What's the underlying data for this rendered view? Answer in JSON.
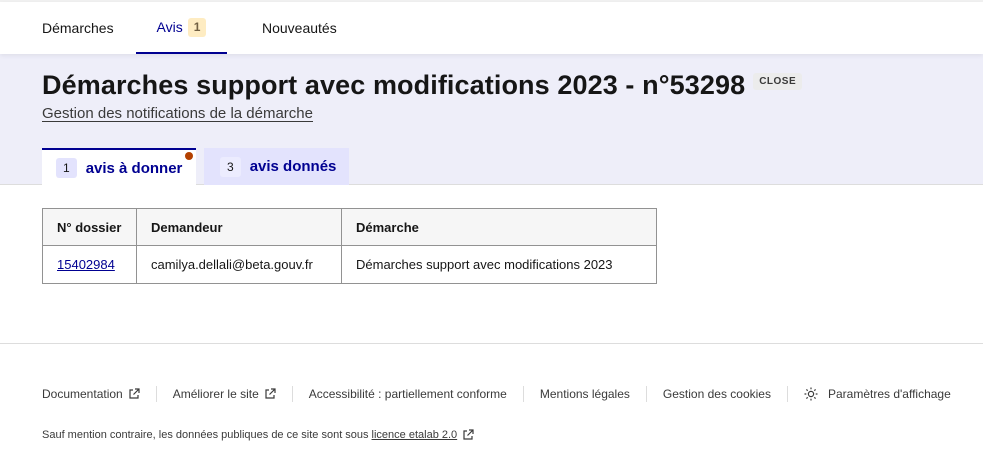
{
  "nav": {
    "tabs": [
      {
        "label": "Démarches"
      },
      {
        "label": "Avis",
        "badge": "1"
      },
      {
        "label": "Nouveautés"
      }
    ],
    "accent": "#000091"
  },
  "hero": {
    "title": "Démarches support avec modifications 2023 - n°53298",
    "status_badge": "CLOSE",
    "manage_link": "Gestion des notifications de la démarche",
    "background": "#eeeef9"
  },
  "subtabs": [
    {
      "count": "1",
      "label": "avis à donner",
      "active": true
    },
    {
      "count": "3",
      "label": "avis donnés",
      "active": false
    }
  ],
  "table": {
    "headers": [
      "N° dossier",
      "Demandeur",
      "Démarche"
    ],
    "rows": [
      [
        "15402984",
        "camilya.dellali@beta.gouv.fr",
        "Démarches support avec modifications 2023"
      ]
    ]
  },
  "footer": {
    "links": [
      {
        "label": "Documentation",
        "icon": "external-link-icon"
      },
      {
        "label": "Améliorer le site",
        "icon": "external-link-icon"
      },
      {
        "label": "Accessibilité : partiellement conforme"
      },
      {
        "label": "Mentions légales"
      },
      {
        "label": "Gestion des cookies"
      },
      {
        "label": "Paramètres d'affichage",
        "icon": "sun-icon"
      }
    ],
    "note_prefix": "Sauf mention contraire, les données publiques de ce site sont sous",
    "licence_label": "licence etalab 2.0"
  }
}
